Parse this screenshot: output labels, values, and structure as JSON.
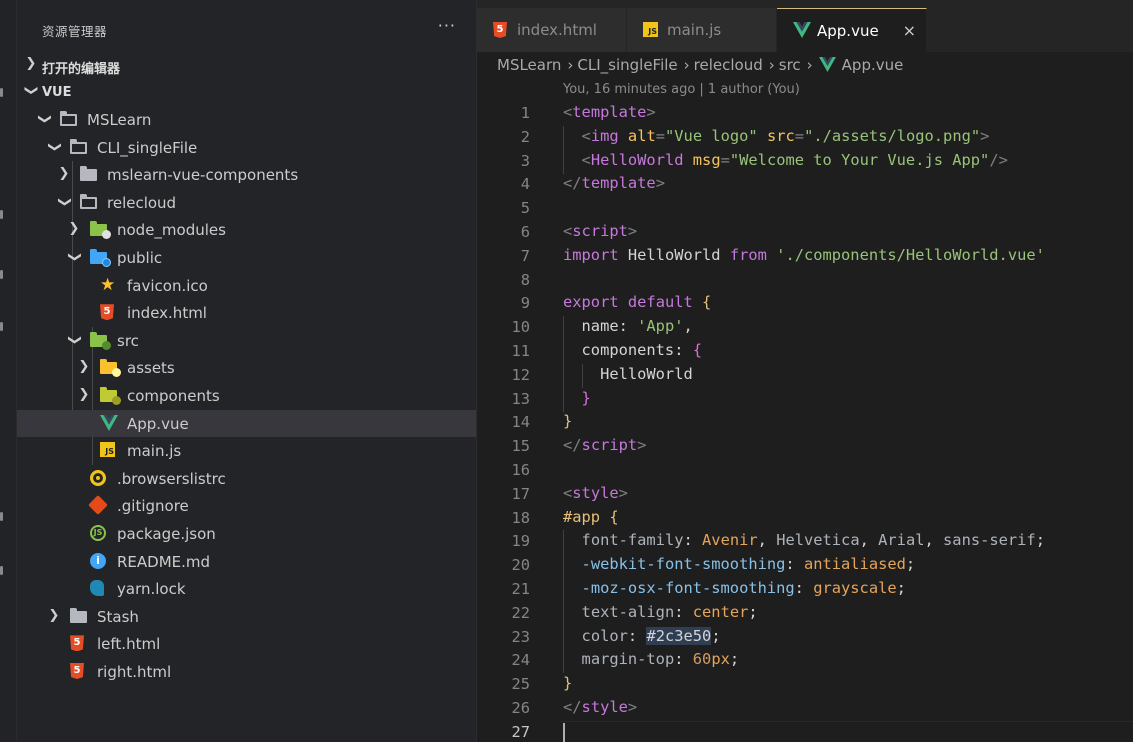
{
  "sidebar": {
    "title": "资源管理器",
    "more": "···",
    "sections": [
      {
        "label": "打开的编辑器",
        "expanded": false
      },
      {
        "label": "VUE",
        "expanded": true
      }
    ],
    "tree": [
      {
        "name": "MSLearn",
        "type": "folder-open",
        "depth": 1
      },
      {
        "name": "CLI_singleFile",
        "type": "folder-open",
        "depth": 2
      },
      {
        "name": "mslearn-vue-components",
        "type": "folder",
        "depth": 3
      },
      {
        "name": "relecloud",
        "type": "folder-open",
        "depth": 3
      },
      {
        "name": "node_modules",
        "type": "folder-node",
        "depth": 4
      },
      {
        "name": "public",
        "type": "folder-public-open",
        "depth": 4
      },
      {
        "name": "favicon.ico",
        "type": "star-icon",
        "depth": 5
      },
      {
        "name": "index.html",
        "type": "html-icon",
        "depth": 5
      },
      {
        "name": "src",
        "type": "folder-src-open",
        "depth": 4
      },
      {
        "name": "assets",
        "type": "folder-assets",
        "depth": 5
      },
      {
        "name": "components",
        "type": "folder-components",
        "depth": 5
      },
      {
        "name": "App.vue",
        "type": "vue-icon",
        "depth": 5,
        "selected": true
      },
      {
        "name": "main.js",
        "type": "js-icon",
        "depth": 5
      },
      {
        "name": ".browserslistrc",
        "type": "browserslist-icon",
        "depth": 4
      },
      {
        "name": ".gitignore",
        "type": "git-icon",
        "depth": 4
      },
      {
        "name": "package.json",
        "type": "node-icon",
        "depth": 4
      },
      {
        "name": "README.md",
        "type": "info-icon",
        "depth": 4
      },
      {
        "name": "yarn.lock",
        "type": "yarn-icon",
        "depth": 4
      },
      {
        "name": "Stash",
        "type": "folder",
        "depth": 2
      },
      {
        "name": "left.html",
        "type": "html-icon",
        "depth": 2
      },
      {
        "name": "right.html",
        "type": "html-icon",
        "depth": 2
      }
    ]
  },
  "tabs": [
    {
      "name": "index.html",
      "icon": "html-icon",
      "active": false
    },
    {
      "name": "main.js",
      "icon": "js-icon",
      "active": false
    },
    {
      "name": "App.vue",
      "icon": "vue-icon",
      "active": true,
      "close": "×"
    }
  ],
  "breadcrumb": [
    "MSLearn",
    "CLI_singleFile",
    "relecloud",
    "src",
    "App.vue"
  ],
  "blame": "You, 16 minutes ago | 1 author (You)",
  "lines": [
    "1",
    "2",
    "3",
    "4",
    "5",
    "6",
    "7",
    "8",
    "9",
    "10",
    "11",
    "12",
    "13",
    "14",
    "15",
    "16",
    "17",
    "18",
    "19",
    "20",
    "21",
    "22",
    "23",
    "24",
    "25",
    "26",
    "27"
  ],
  "colors": {
    "sidebar_bg": "#232427",
    "editor_bg": "#1e1e1e",
    "selected_row": "#37373d",
    "active_tab_border": "#d7ba7d"
  }
}
